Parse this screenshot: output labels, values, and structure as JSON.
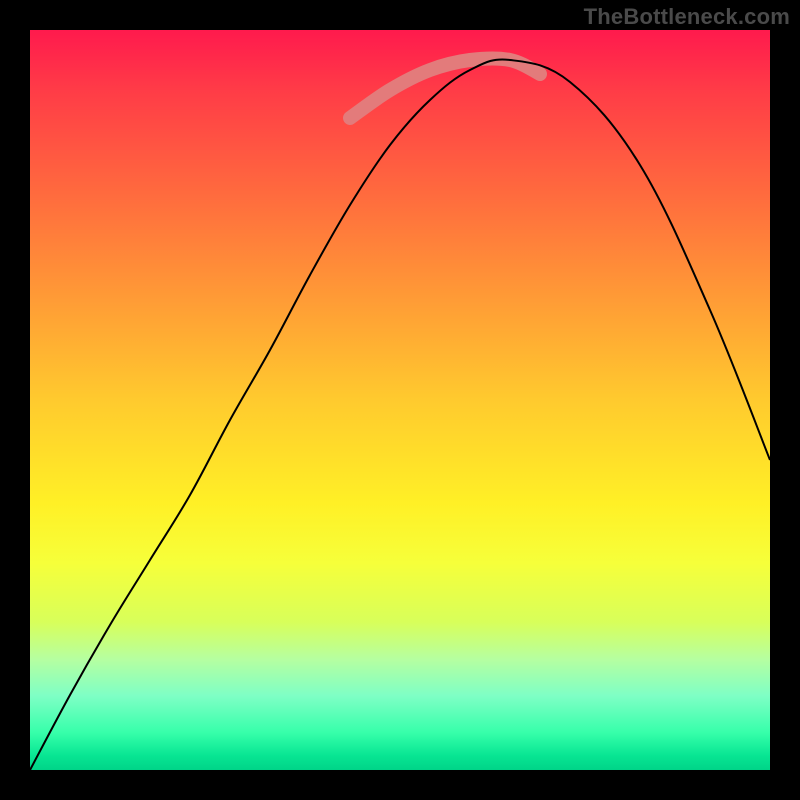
{
  "watermark": {
    "text": "TheBottleneck.com"
  },
  "chart_data": {
    "type": "line",
    "title": "",
    "xlabel": "",
    "ylabel": "",
    "x": [
      30,
      70,
      110,
      150,
      190,
      230,
      270,
      310,
      350,
      390,
      430,
      470,
      510,
      570,
      640,
      710,
      770
    ],
    "series": [
      {
        "name": "bottleneck-curve",
        "values": [
          30,
          105,
          175,
          240,
          305,
          380,
          450,
          525,
          595,
          655,
          700,
          730,
          740,
          718,
          635,
          490,
          340
        ]
      }
    ],
    "highlight": {
      "name": "optimal-zone",
      "x": [
        350,
        390,
        430,
        470,
        510,
        540
      ],
      "values": [
        682,
        710,
        730,
        740,
        740,
        726
      ]
    },
    "xlim": [
      30,
      770
    ],
    "ylim": [
      30,
      770
    ],
    "gradient_colors": {
      "top": "#ff1a4d",
      "mid_orange": "#ff9a36",
      "mid_yellow": "#fff026",
      "bottom": "#00d488"
    }
  }
}
